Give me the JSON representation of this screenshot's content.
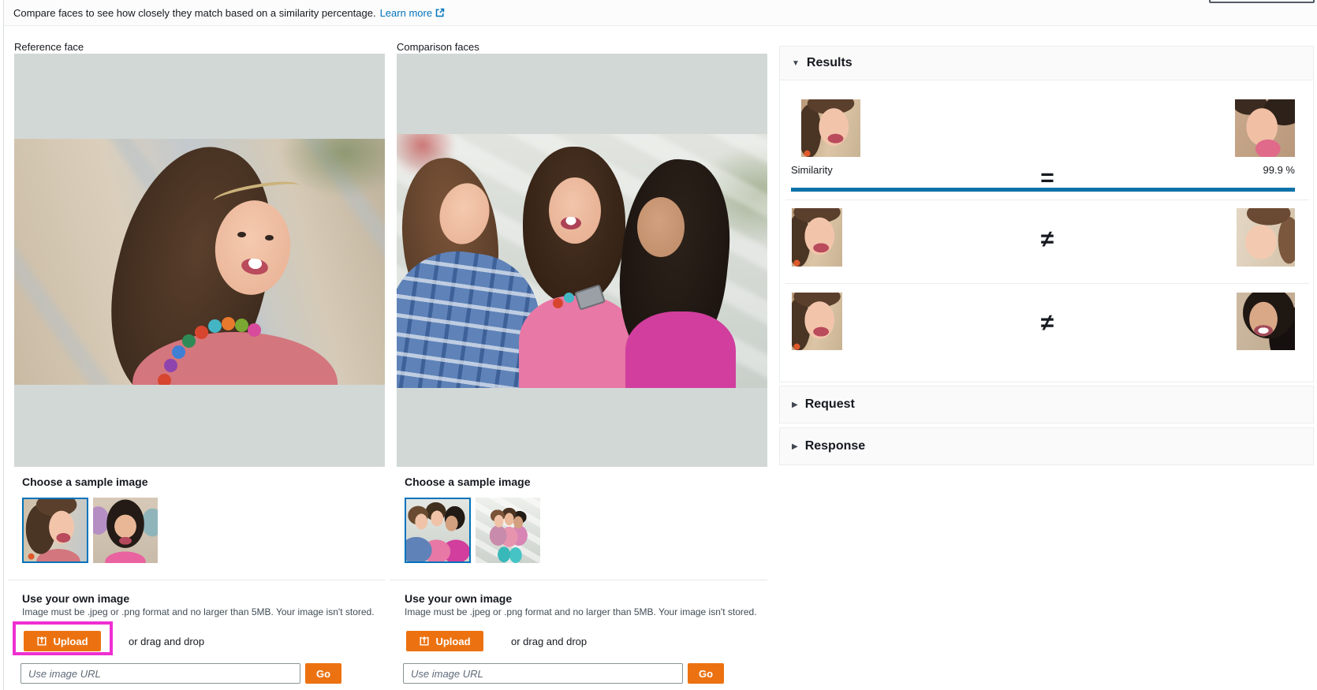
{
  "banner": {
    "text": "Compare faces to see how closely they match based on a similarity percentage.",
    "learn_more_label": "Learn more"
  },
  "reference": {
    "label": "Reference face",
    "sample_heading": "Choose a sample image",
    "own_image": {
      "heading": "Use your own image",
      "note": "Image must be .jpeg or .png format and no larger than 5MB. Your image isn't stored.",
      "upload_label": "Upload",
      "drag_label": "or drag and drop",
      "url_placeholder": "Use image URL",
      "go_label": "Go"
    }
  },
  "comparison": {
    "label": "Comparison faces",
    "sample_heading": "Choose a sample image",
    "own_image": {
      "heading": "Use your own image",
      "note": "Image must be .jpeg or .png format and no larger than 5MB. Your image isn't stored.",
      "upload_label": "Upload",
      "drag_label": "or drag and drop",
      "url_placeholder": "Use image URL",
      "go_label": "Go"
    }
  },
  "results": {
    "title": "Results",
    "caret": "▼",
    "rows": [
      {
        "relation": "=",
        "similarity_label": "Similarity",
        "similarity_value": "99.9 %"
      },
      {
        "relation": "≠"
      },
      {
        "relation": "≠"
      }
    ]
  },
  "request_section": {
    "title": "Request",
    "caret": "▶"
  },
  "response_section": {
    "title": "Response",
    "caret": "▶"
  },
  "icons": {
    "learn_more": "external-link-icon",
    "upload": "upload-icon"
  },
  "colors": {
    "accent_orange": "#ec7211",
    "link_blue": "#0073bb",
    "progress_blue": "#0b72a9",
    "selected_thumb_blue": "#0073bb",
    "annotation_magenta": "#ef2fd1",
    "canvas_gray": "#d2d8d6"
  }
}
